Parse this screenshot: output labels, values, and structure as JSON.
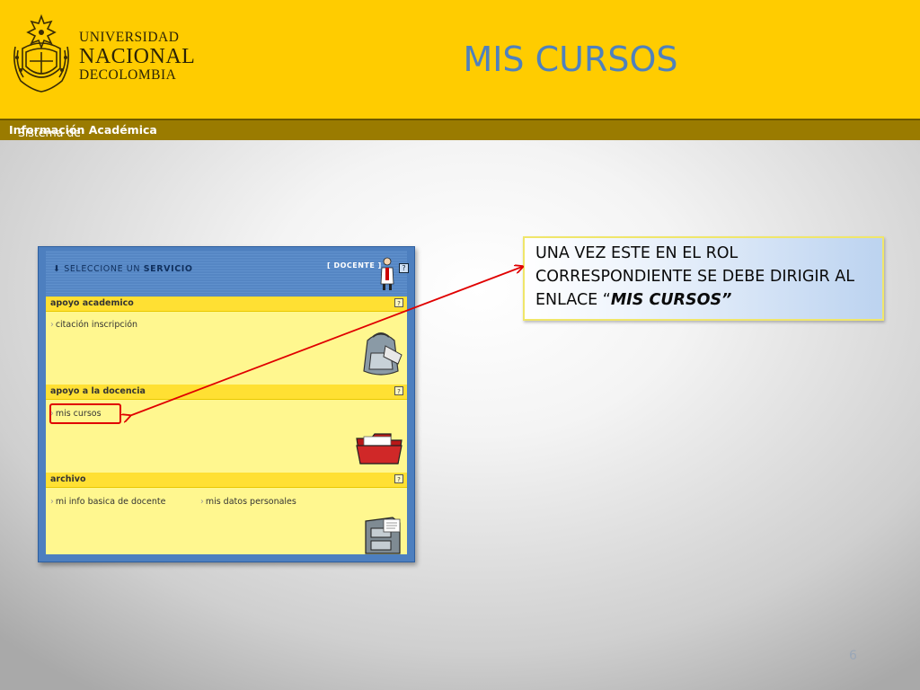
{
  "header": {
    "university": {
      "line1": "UNIVERSIDAD",
      "line2": "NACIONAL",
      "line3_prefix": "DE",
      "line3": "COLOMBIA"
    },
    "title": "MIS CURSOS",
    "subbar_plain": "Sistema de",
    "subbar_bold": "Información Académica",
    "colors": {
      "header_bg": "#ffcc00",
      "subbar_bg": "#9a7b00",
      "title": "#4f81bd"
    }
  },
  "panel": {
    "select_prefix": "SELECCIONE UN",
    "select_bold": "SERVICIO",
    "role_badge": "[ DOCENTE ]",
    "help_glyph": "?",
    "sections": [
      {
        "title": "apoyo academico",
        "items": [
          "citación inscripción"
        ],
        "icon": "backpack-icon"
      },
      {
        "title": "apoyo a la docencia",
        "items": [
          "mis cursos"
        ],
        "icon": "folder-icon"
      },
      {
        "title": "archivo",
        "items": [
          "mi info basica de docente",
          "mis datos personales"
        ],
        "icon": "file-cabinet-icon"
      }
    ]
  },
  "callout": {
    "text": "UNA VEZ ESTE EN EL ROL CORRESPONDIENTE SE DEBE DIRIGIR AL ENLACE  “",
    "emphasis": "MIS CURSOS”"
  },
  "slide_number": "6"
}
